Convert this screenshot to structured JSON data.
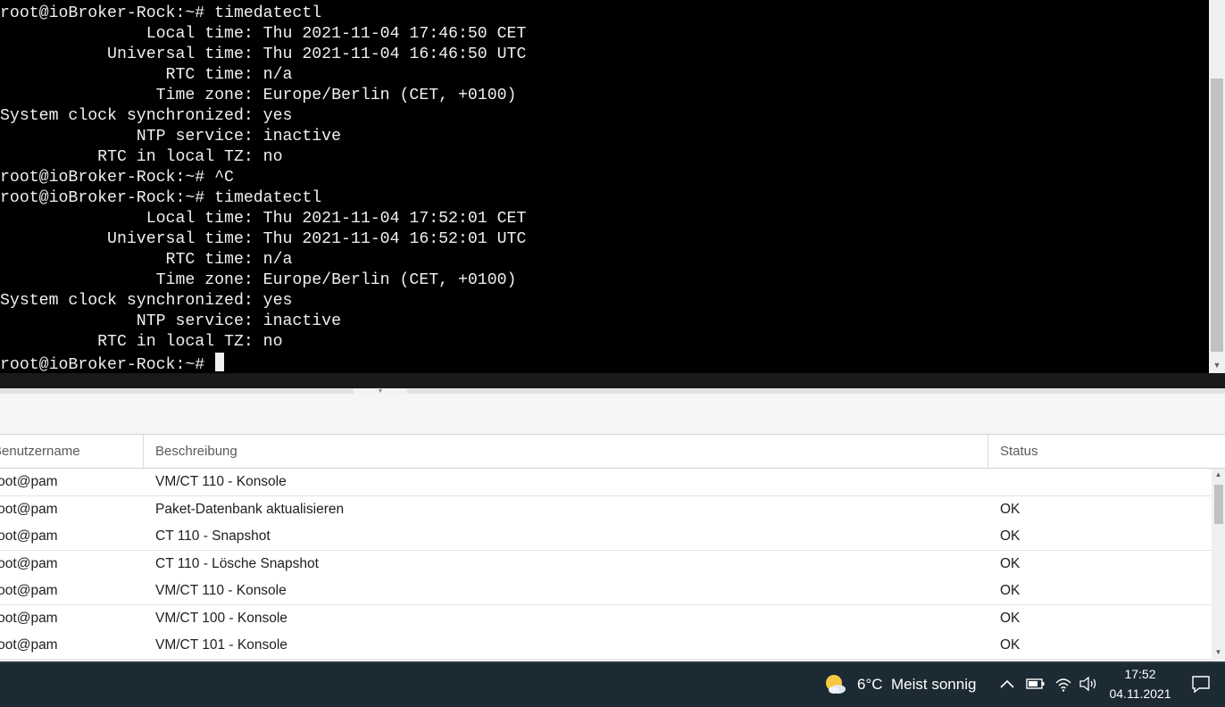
{
  "terminal": {
    "lines": [
      "root@ioBroker-Rock:~# timedatectl",
      "               Local time: Thu 2021-11-04 17:46:50 CET",
      "           Universal time: Thu 2021-11-04 16:46:50 UTC",
      "                 RTC time: n/a",
      "                Time zone: Europe/Berlin (CET, +0100)",
      "System clock synchronized: yes",
      "              NTP service: inactive",
      "          RTC in local TZ: no",
      "root@ioBroker-Rock:~# ^C",
      "root@ioBroker-Rock:~# timedatectl",
      "               Local time: Thu 2021-11-04 17:52:01 CET",
      "           Universal time: Thu 2021-11-04 16:52:01 UTC",
      "                 RTC time: n/a",
      "                Time zone: Europe/Berlin (CET, +0100)",
      "System clock synchronized: yes",
      "              NTP service: inactive",
      "          RTC in local TZ: no"
    ],
    "prompt": "root@ioBroker-Rock:~# "
  },
  "tasks": {
    "columns": {
      "user": "Benutzername",
      "description": "Beschreibung",
      "status": "Status"
    },
    "rows": [
      {
        "user": "root@pam",
        "description": "VM/CT 110 - Konsole",
        "status": ""
      },
      {
        "user": "root@pam",
        "description": "Paket-Datenbank aktualisieren",
        "status": "OK"
      },
      {
        "user": "root@pam",
        "description": "CT 110 - Snapshot",
        "status": "OK"
      },
      {
        "user": "root@pam",
        "description": "CT 110 - Lösche Snapshot",
        "status": "OK"
      },
      {
        "user": "root@pam",
        "description": "VM/CT 110 - Konsole",
        "status": "OK"
      },
      {
        "user": "root@pam",
        "description": "VM/CT 100 - Konsole",
        "status": "OK"
      },
      {
        "user": "root@pam",
        "description": "VM/CT 101 - Konsole",
        "status": "OK"
      }
    ]
  },
  "taskbar": {
    "weather": {
      "temperature": "6°C",
      "condition": "Meist sonnig",
      "icon": "partly-sunny-icon"
    },
    "tray_icons": [
      "chevron-up-icon",
      "battery-icon",
      "wifi-icon",
      "volume-icon"
    ],
    "clock": {
      "time": "17:52",
      "date": "04.11.2021"
    },
    "notification_icon": "notification-icon"
  },
  "colors": {
    "terminal_bg": "#000000",
    "terminal_fg": "#f0f0f0",
    "taskbar_bg": "#1c2a33",
    "weather_sun": "#f7c744"
  }
}
